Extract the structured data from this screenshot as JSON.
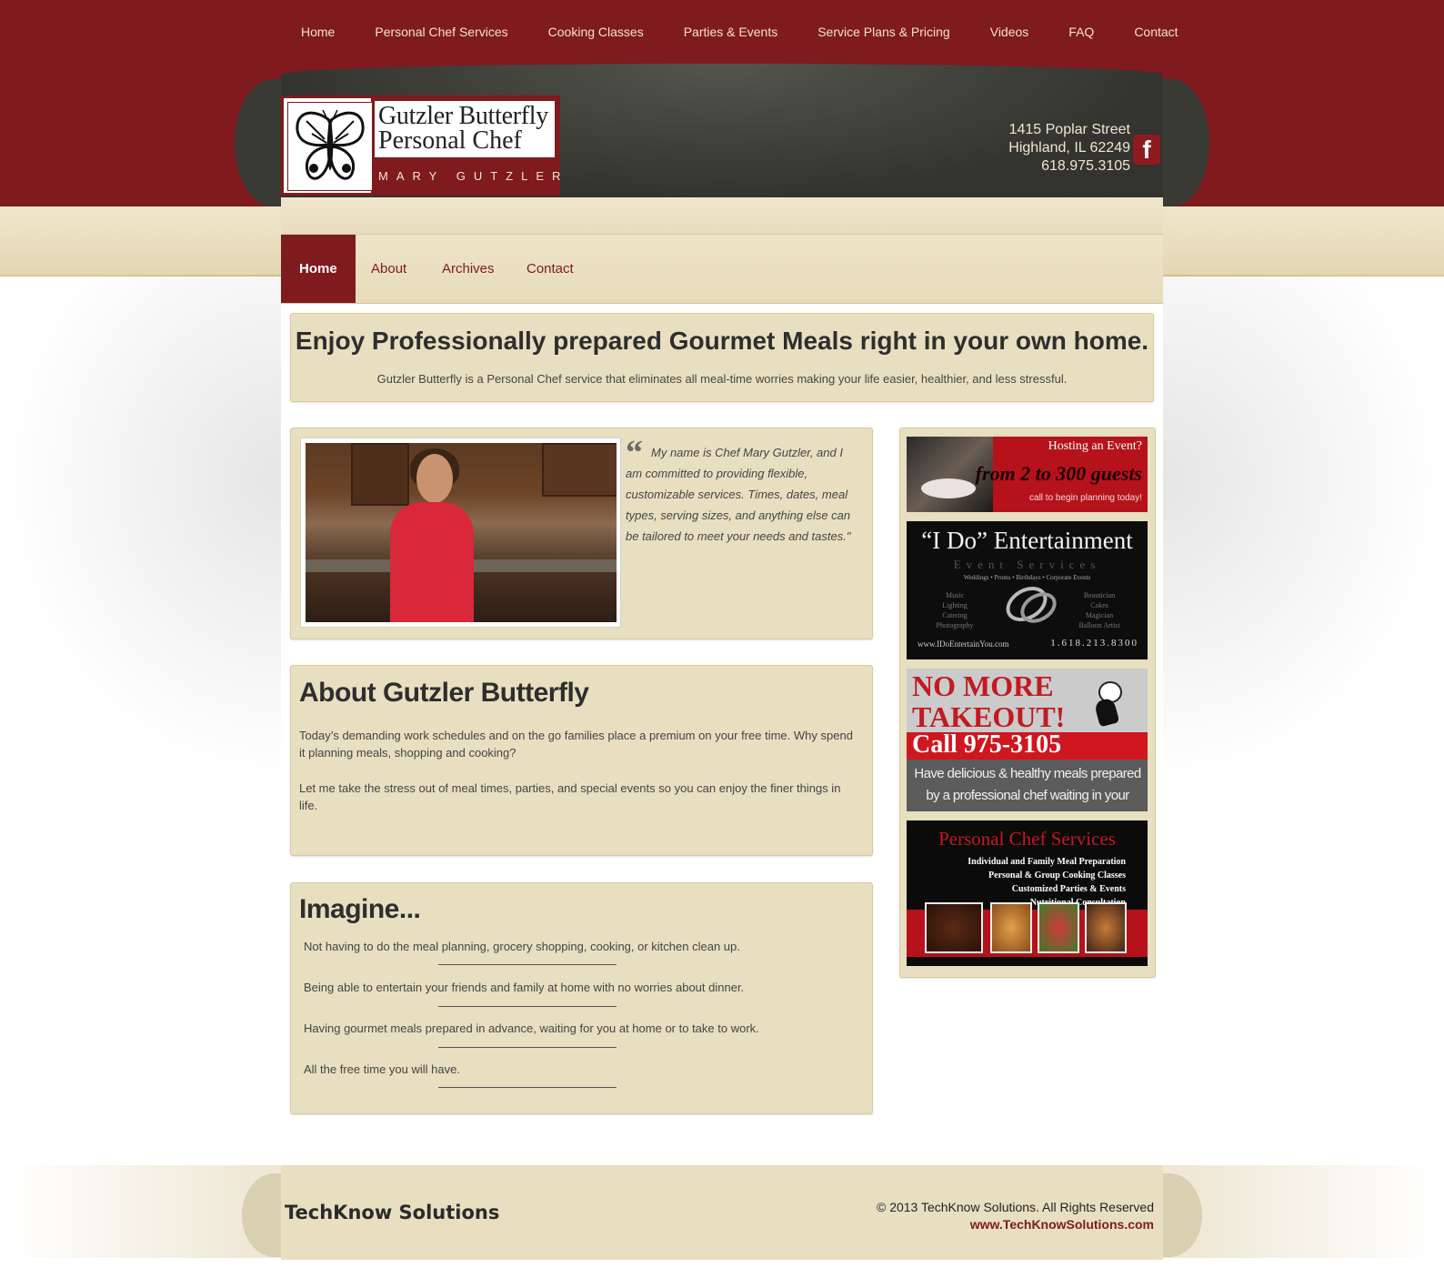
{
  "top_nav": [
    "Home",
    "Personal Chef Services",
    "Cooking Classes",
    "Parties & Events",
    "Service Plans & Pricing",
    "Videos",
    "FAQ",
    "Contact"
  ],
  "logo": {
    "title_line1": "Gutzler Butterfly",
    "title_line2": "Personal Chef",
    "subtitle": "MARY GUTZLER"
  },
  "address": {
    "street": "1415 Poplar Street",
    "city": "Highland, IL 62249",
    "phone": "618.975.3105"
  },
  "facebook_letter": "f",
  "main_nav": {
    "active": "Home",
    "items": [
      "About",
      "Archives",
      "Contact"
    ]
  },
  "hero": {
    "title": "Enjoy Professionally prepared Gourmet Meals right in your own home.",
    "text": "Gutzler Butterfly is a Personal Chef service that eliminates all meal-time worries making your life easier, healthier, and less stressful."
  },
  "intro_quote": "My name is Chef Mary Gutzler, and I am committed to providing flexible, customizable services. Times, dates, meal types, serving sizes, and anything else can be tailored to meet your needs and tastes.\"",
  "about": {
    "title": "About Gutzler Butterfly",
    "p1": "Today’s demanding work schedules and on the go families place a premium on your free time. Why spend it planning meals, shopping and cooking?",
    "p2": "Let me take the stress out of meal times, parties, and special events so you can enjoy the finer things in life."
  },
  "imagine": {
    "title": "Imagine...",
    "items": [
      "Not having to do the meal planning, grocery shopping, cooking, or kitchen clean up.",
      "Being able to entertain your friends and family at home with no worries about dinner.",
      "Having gourmet meals prepared in advance, waiting for you at home or to take to work.",
      "All the free time you will have."
    ]
  },
  "ads": {
    "event": {
      "title": "Hosting an Event?",
      "range": "from 2 to 300 guests",
      "cta": "call to begin planning today!"
    },
    "ido": {
      "title": "“I Do” Entertainment",
      "subtitle": "Event Services",
      "tagline": "Weddings • Proms • Birthdays • Corporate Events",
      "left_col": "Music\nLighting\nCatering\nPhotography",
      "right_col": "Beautician\nCakes\nMagician\nBalloon Artist",
      "url": "www.IDoEntertainYou.com",
      "phone": "1.618.213.8300"
    },
    "takeout": {
      "title": "NO MORE TAKEOUT!",
      "call": "Call 975-3105",
      "text": "Have delicious & healthy meals prepared by a professional chef waiting in your refrigerator."
    },
    "services": {
      "title": "Personal Chef Services",
      "lines": [
        "Individual and Family Meal Preparation",
        "Personal & Group Cooking Classes",
        "Customized Parties & Events",
        "Nutritional Consultation"
      ]
    }
  },
  "footer": {
    "brand": "TechKnow Solutions",
    "copyright": "© 2013 TechKnow Solutions. All Rights Reserved",
    "url": "www.TechKnowSolutions.com"
  },
  "colors": {
    "brand_red": "#7f1a1f",
    "cream": "#e8dfc1",
    "header_dark": "#3a3a35"
  }
}
